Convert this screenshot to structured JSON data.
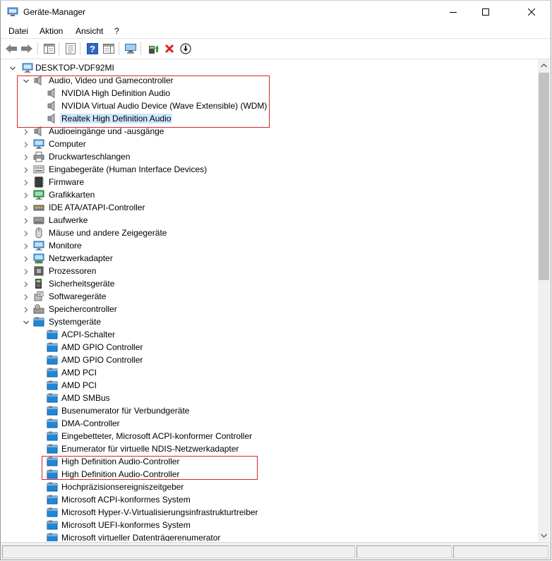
{
  "window": {
    "title": "Geräte-Manager",
    "controls": [
      "minimize",
      "maximize",
      "close"
    ]
  },
  "menu": {
    "items": [
      {
        "label": "Datei"
      },
      {
        "label": "Aktion"
      },
      {
        "label": "Ansicht"
      },
      {
        "label": "?"
      }
    ]
  },
  "toolbar": {
    "buttons": [
      {
        "name": "back-icon"
      },
      {
        "name": "forward-icon"
      },
      {
        "name": "show-hide-console-tree-icon"
      },
      {
        "name": "properties-icon"
      },
      {
        "name": "help-icon"
      },
      {
        "name": "action-pane-icon"
      },
      {
        "name": "scan-hardware-icon"
      },
      {
        "name": "update-driver-icon"
      },
      {
        "name": "uninstall-device-icon"
      },
      {
        "name": "disable-device-icon"
      }
    ]
  },
  "tree": {
    "root": "DESKTOP-VDF92MI",
    "rows": [
      {
        "level": 0,
        "label": "DESKTOP-VDF92MI",
        "icon": "computer-icon",
        "expander": "expanded"
      },
      {
        "level": 1,
        "label": "Audio, Video und Gamecontroller",
        "icon": "speaker-icon",
        "expander": "expanded"
      },
      {
        "level": 2,
        "label": "NVIDIA High Definition Audio",
        "icon": "speaker-icon",
        "expander": "none"
      },
      {
        "level": 2,
        "label": "NVIDIA Virtual Audio Device (Wave Extensible) (WDM)",
        "icon": "speaker-icon",
        "expander": "none"
      },
      {
        "level": 2,
        "label": "Realtek High Definition Audio",
        "icon": "speaker-icon",
        "expander": "none",
        "selected": true
      },
      {
        "level": 1,
        "label": "Audioeingänge und -ausgänge",
        "icon": "speaker-icon",
        "expander": "collapsed"
      },
      {
        "level": 1,
        "label": "Computer",
        "icon": "monitor-icon",
        "expander": "collapsed"
      },
      {
        "level": 1,
        "label": "Druckwarteschlangen",
        "icon": "printer-icon",
        "expander": "collapsed"
      },
      {
        "level": 1,
        "label": "Eingabegeräte (Human Interface Devices)",
        "icon": "hid-icon",
        "expander": "collapsed"
      },
      {
        "level": 1,
        "label": "Firmware",
        "icon": "chip-icon",
        "expander": "collapsed"
      },
      {
        "level": 1,
        "label": "Grafikkarten",
        "icon": "display-adapter-icon",
        "expander": "collapsed"
      },
      {
        "level": 1,
        "label": "IDE ATA/ATAPI-Controller",
        "icon": "ide-icon",
        "expander": "collapsed"
      },
      {
        "level": 1,
        "label": "Laufwerke",
        "icon": "disk-icon",
        "expander": "collapsed"
      },
      {
        "level": 1,
        "label": "Mäuse und andere Zeigegeräte",
        "icon": "mouse-icon",
        "expander": "collapsed"
      },
      {
        "level": 1,
        "label": "Monitore",
        "icon": "monitor-icon",
        "expander": "collapsed"
      },
      {
        "level": 1,
        "label": "Netzwerkadapter",
        "icon": "network-icon",
        "expander": "collapsed"
      },
      {
        "level": 1,
        "label": "Prozessoren",
        "icon": "cpu-icon",
        "expander": "collapsed"
      },
      {
        "level": 1,
        "label": "Sicherheitsgeräte",
        "icon": "security-icon",
        "expander": "collapsed"
      },
      {
        "level": 1,
        "label": "Softwaregeräte",
        "icon": "software-device-icon",
        "expander": "collapsed"
      },
      {
        "level": 1,
        "label": "Speichercontroller",
        "icon": "storage-controller-icon",
        "expander": "collapsed"
      },
      {
        "level": 1,
        "label": "Systemgeräte",
        "icon": "system-device-icon",
        "expander": "expanded"
      },
      {
        "level": 2,
        "label": "ACPI-Schalter",
        "icon": "system-device-icon",
        "expander": "none"
      },
      {
        "level": 2,
        "label": "AMD GPIO Controller",
        "icon": "system-device-icon",
        "expander": "none"
      },
      {
        "level": 2,
        "label": "AMD GPIO Controller",
        "icon": "system-device-icon",
        "expander": "none"
      },
      {
        "level": 2,
        "label": "AMD PCI",
        "icon": "system-device-icon",
        "expander": "none"
      },
      {
        "level": 2,
        "label": "AMD PCI",
        "icon": "system-device-icon",
        "expander": "none"
      },
      {
        "level": 2,
        "label": "AMD SMBus",
        "icon": "system-device-icon",
        "expander": "none"
      },
      {
        "level": 2,
        "label": "Busenumerator für Verbundgeräte",
        "icon": "system-device-icon",
        "expander": "none"
      },
      {
        "level": 2,
        "label": "DMA-Controller",
        "icon": "system-device-icon",
        "expander": "none"
      },
      {
        "level": 2,
        "label": "Eingebetteter, Microsoft ACPI-konformer Controller",
        "icon": "system-device-icon",
        "expander": "none"
      },
      {
        "level": 2,
        "label": "Enumerator für virtuelle NDIS-Netzwerkadapter",
        "icon": "system-device-icon",
        "expander": "none"
      },
      {
        "level": 2,
        "label": "High Definition Audio-Controller",
        "icon": "system-device-icon",
        "expander": "none"
      },
      {
        "level": 2,
        "label": "High Definition Audio-Controller",
        "icon": "system-device-icon",
        "expander": "none"
      },
      {
        "level": 2,
        "label": "Hochpräzisionsereigniszeitgeber",
        "icon": "system-device-icon",
        "expander": "none"
      },
      {
        "level": 2,
        "label": "Microsoft ACPI-konformes System",
        "icon": "system-device-icon",
        "expander": "none"
      },
      {
        "level": 2,
        "label": "Microsoft Hyper-V-Virtualisierungsinfrastrukturtreiber",
        "icon": "system-device-icon",
        "expander": "none"
      },
      {
        "level": 2,
        "label": "Microsoft UEFI-konformes System",
        "icon": "system-device-icon",
        "expander": "none"
      },
      {
        "level": 2,
        "label": "Microsoft virtueller Datenträgerenumerator",
        "icon": "system-device-icon",
        "expander": "none"
      }
    ]
  },
  "colors": {
    "selection": "#cce8ff",
    "highlight_box": "#d7262e",
    "system_device_blue": "#1e88d8"
  }
}
